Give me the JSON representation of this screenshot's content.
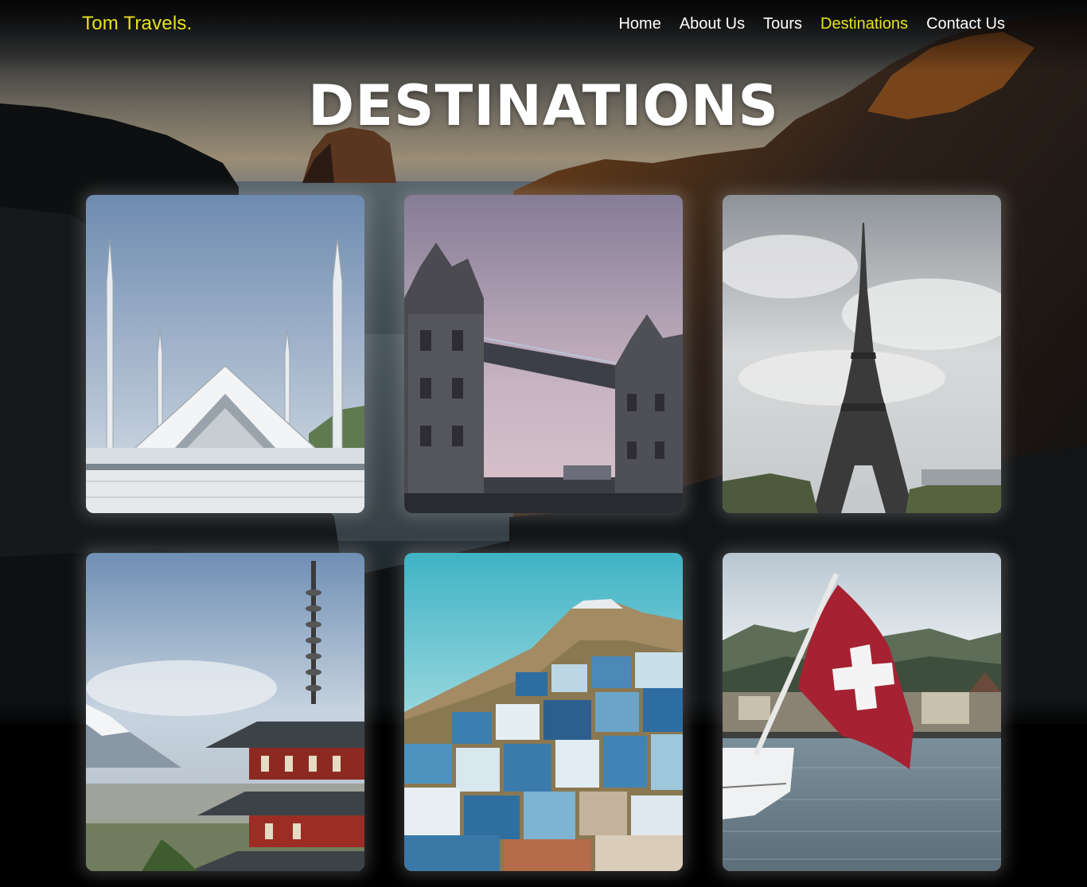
{
  "brand": {
    "name": "Tom Travels.",
    "color": "#e8e21a"
  },
  "nav": {
    "items": [
      {
        "label": "Home",
        "active": false
      },
      {
        "label": "About Us",
        "active": false
      },
      {
        "label": "Tours",
        "active": false
      },
      {
        "label": "Destinations",
        "active": true
      },
      {
        "label": "Contact Us",
        "active": false
      }
    ],
    "active_color": "#e8e21a"
  },
  "page": {
    "title": "DESTINATIONS"
  },
  "destinations": [
    {
      "image": "mosque-minarets-photo"
    },
    {
      "image": "tower-bridge-photo"
    },
    {
      "image": "eiffel-tower-photo"
    },
    {
      "image": "pagoda-mountain-photo"
    },
    {
      "image": "blue-town-hillside-photo"
    },
    {
      "image": "swiss-flag-lake-photo"
    }
  ]
}
